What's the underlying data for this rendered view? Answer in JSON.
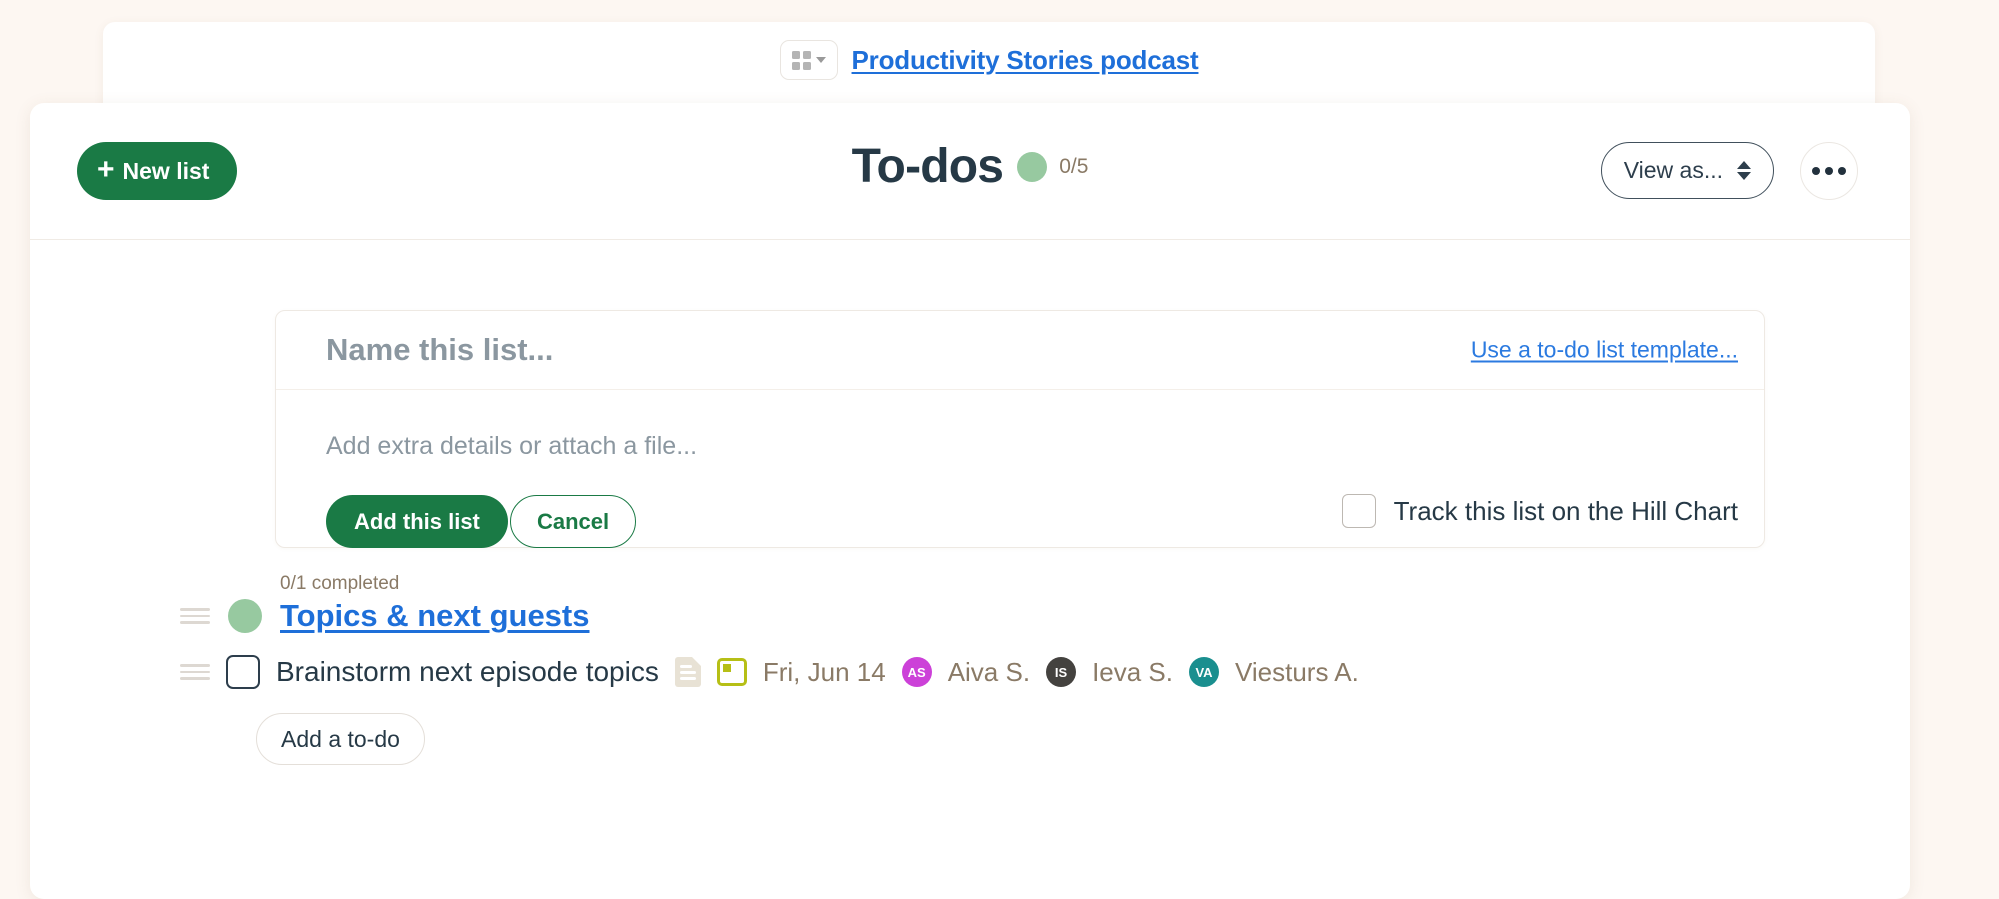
{
  "breadcrumb": {
    "grid_icon": "grid-menu-icon",
    "chevron_icon": "chevron-down-icon",
    "project_name": "Productivity Stories podcast"
  },
  "header": {
    "new_list_label": "New list",
    "plus_icon": "plus-icon",
    "title": "To-dos",
    "progress_count": "0/5",
    "progress_dot_color": "#97c9a0",
    "view_as_label": "View as...",
    "view_as_icon": "up-down-chevron-icon",
    "more_icon": "ellipsis-icon"
  },
  "composer": {
    "name_placeholder": "Name this list...",
    "name_value": "",
    "template_link": "Use a to-do list template...",
    "details_placeholder": "Add extra details or attach a file...",
    "details_value": "",
    "add_label": "Add this list",
    "cancel_label": "Cancel",
    "hill_chart_label": "Track this list on the Hill Chart",
    "hill_chart_checked": false
  },
  "list_group": {
    "completed_text": "0/1 completed",
    "dot_color": "#97c9a0",
    "name": "Topics & next guests",
    "drag_icon": "drag-handle-icon",
    "add_todo_label": "Add a to-do",
    "todos": [
      {
        "checked": false,
        "title": "Brainstorm next episode topics",
        "notes_icon": "document-notes-icon",
        "date_icon": "calendar-icon",
        "due_date": "Fri, Jun 14",
        "assignees": [
          {
            "initials": "AS",
            "name": "Aiva S.",
            "color": "#cc41d8"
          },
          {
            "initials": "IS",
            "name": "Ieva S.",
            "color": "#44423f"
          },
          {
            "initials": "VA",
            "name": "Viesturs A.",
            "color": "#1a8f8f"
          }
        ]
      }
    ]
  },
  "colors": {
    "background": "#fdf7f2",
    "brand_green": "#1a7a45",
    "link_blue": "#1e6fd9",
    "text_dark": "#263946",
    "muted_brown": "#8a7a66"
  }
}
